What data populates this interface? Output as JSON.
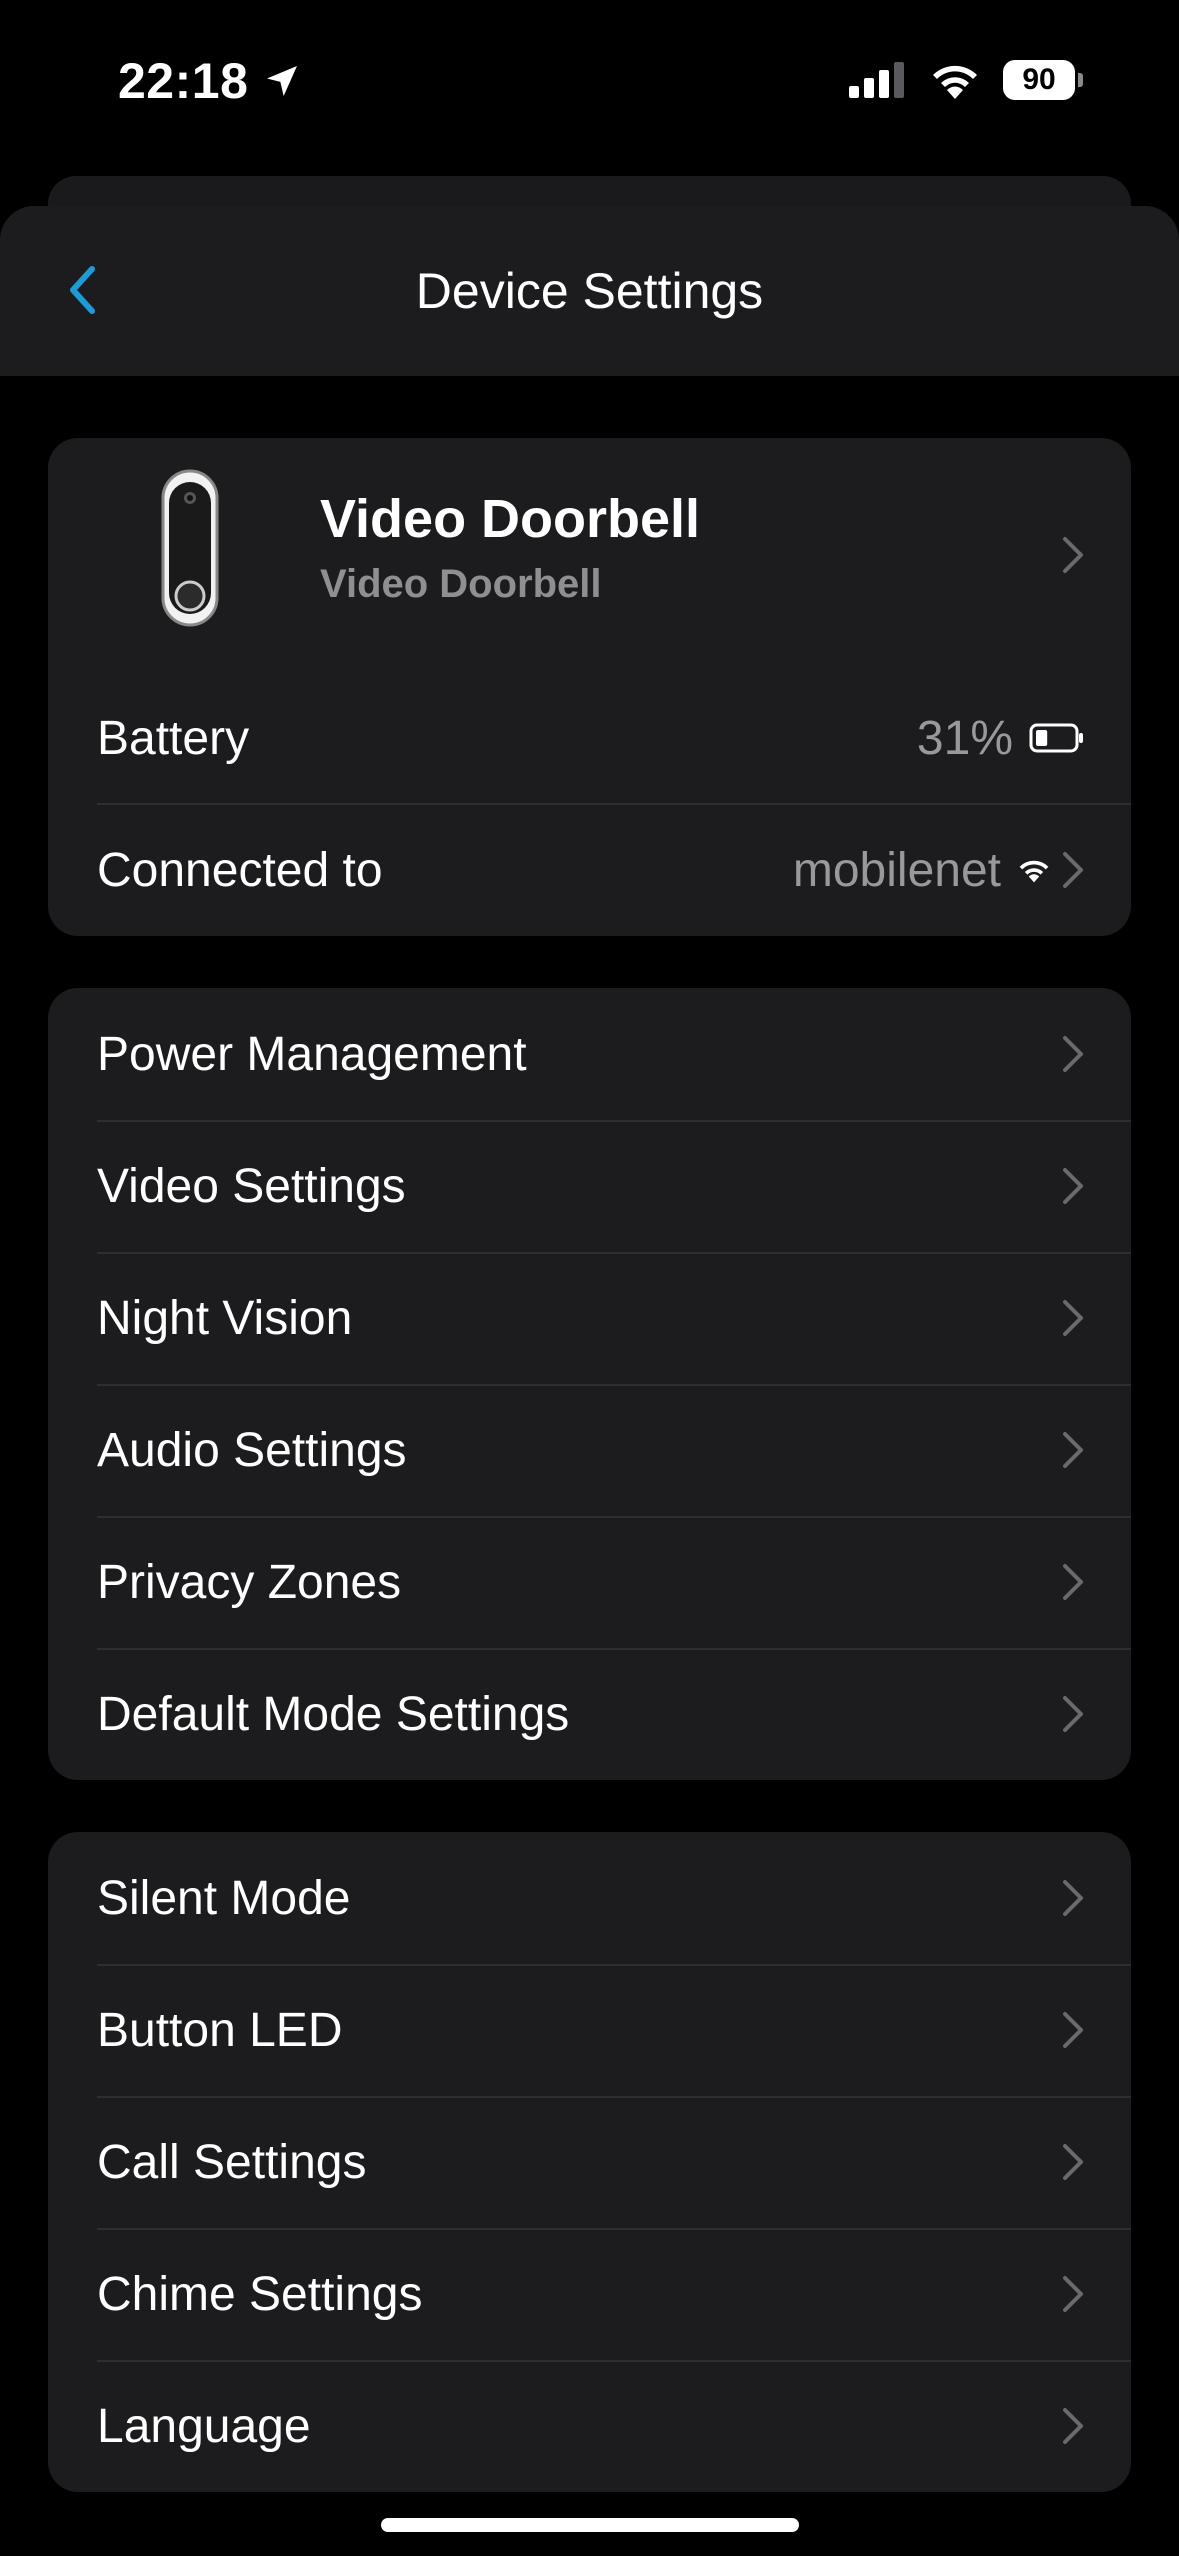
{
  "status_bar": {
    "time": "22:18",
    "battery": "90"
  },
  "nav": {
    "title": "Device Settings"
  },
  "device": {
    "name": "Video Doorbell",
    "model": "Video Doorbell",
    "battery_label": "Battery",
    "battery_value": "31%",
    "battery_level": 0.31,
    "connected_label": "Connected to",
    "network": "mobilenet"
  },
  "group1": [
    {
      "label": "Power Management"
    },
    {
      "label": "Video Settings"
    },
    {
      "label": "Night Vision"
    },
    {
      "label": "Audio Settings"
    },
    {
      "label": "Privacy Zones"
    },
    {
      "label": "Default Mode Settings"
    }
  ],
  "group2": [
    {
      "label": "Silent Mode"
    },
    {
      "label": "Button LED"
    },
    {
      "label": "Call Settings"
    },
    {
      "label": "Chime Settings"
    },
    {
      "label": "Language"
    }
  ],
  "colors": {
    "accent": "#1e9bd7",
    "card": "#1c1c1e",
    "secondary_text": "#98989d"
  },
  "icons": [
    "location-arrow-icon",
    "cellular-signal-icon",
    "wifi-icon",
    "battery-icon",
    "back-chevron-icon",
    "chevron-right-icon",
    "doorbell-icon",
    "wifi-small-icon"
  ]
}
